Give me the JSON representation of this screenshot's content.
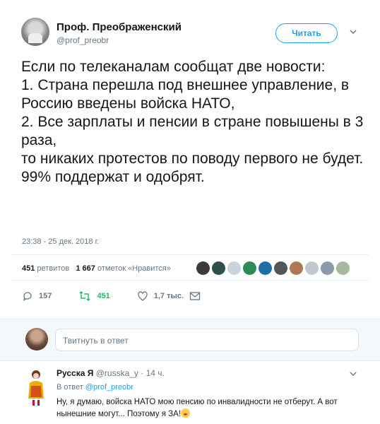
{
  "tweet": {
    "author_name": "Проф. Преображенский",
    "author_handle": "@prof_preobr",
    "follow_label": "Читать",
    "text": "Если по телеканалам сообщат две новости:\n1. Страна перешла под внешнее управление, в Россию введены войска НАТО,\n2. Все зарплаты и пенсии в стране повышены в 3 раза,\nто никаких протестов по поводу первого не будет.\n99% поддержат и одобрят.",
    "timestamp": "23:38 - 25 дек. 2018 г.",
    "retweets_count": "451",
    "retweets_label": "ретвитов",
    "likes_count": "1 667",
    "likes_label": "отметок «Нравится»",
    "liker_avatar_colors": [
      "#3b3b3b",
      "#2f4f4f",
      "#c8d3dc",
      "#2e8b57",
      "#1e6fa8",
      "#555555",
      "#b07850",
      "#c0c8d0",
      "#8a9ba8",
      "#a8b8a0"
    ]
  },
  "actions": {
    "reply_count": "157",
    "retweet_count": "451",
    "like_count": "1,7 тыс."
  },
  "colors": {
    "accent": "#1da1f2",
    "retweet": "#17bf63",
    "muted": "#657786"
  },
  "reply_box": {
    "placeholder": "Твитнуть в ответ"
  },
  "comment": {
    "name": "Русска Я",
    "handle": "@russka_y",
    "time": "· 14 ч.",
    "reply_to_prefix": "В ответ",
    "reply_to_handle": "@prof_preobr",
    "text": "Ну, я думаю, войска НАТО мою пенсию по инвалидности не отберут. А вот нынешние могут... Поэтому я ЗА!"
  }
}
